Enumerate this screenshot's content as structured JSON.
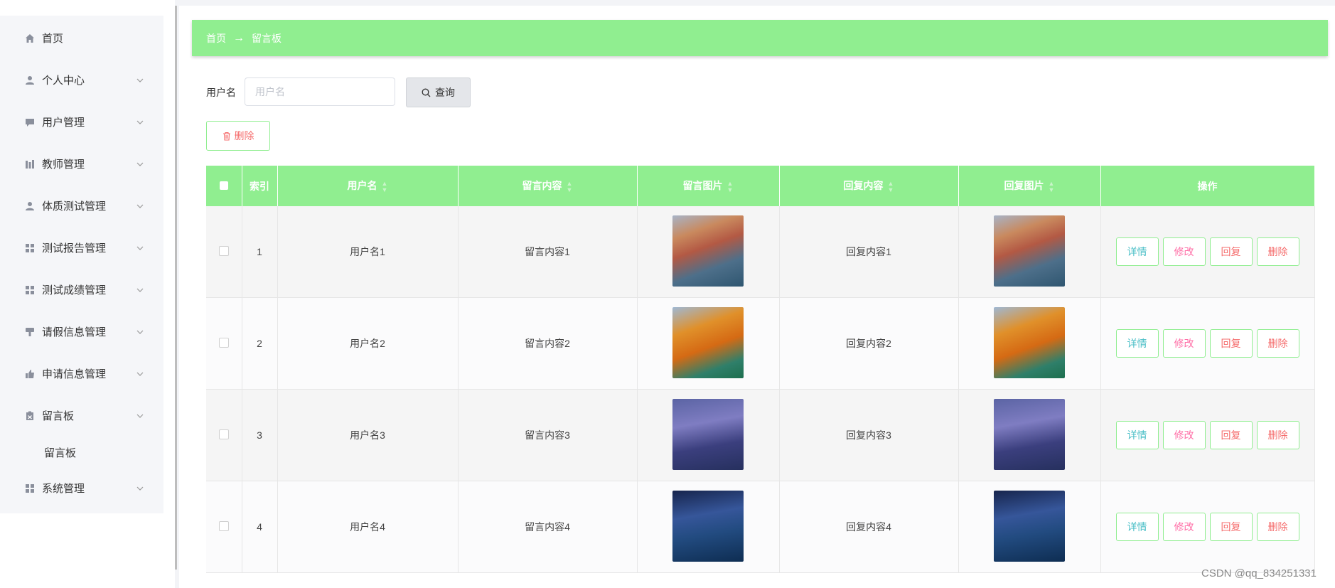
{
  "sidebar": {
    "items": [
      {
        "label": "首页",
        "icon": "home-icon",
        "has_arrow": false
      },
      {
        "label": "个人中心",
        "icon": "user-icon",
        "has_arrow": true
      },
      {
        "label": "用户管理",
        "icon": "chat-icon",
        "has_arrow": true
      },
      {
        "label": "教师管理",
        "icon": "bars-icon",
        "has_arrow": true
      },
      {
        "label": "体质测试管理",
        "icon": "user-icon",
        "has_arrow": true
      },
      {
        "label": "测试报告管理",
        "icon": "grid-icon",
        "has_arrow": true
      },
      {
        "label": "测试成绩管理",
        "icon": "grid-icon",
        "has_arrow": true
      },
      {
        "label": "请假信息管理",
        "icon": "brush-icon",
        "has_arrow": true
      },
      {
        "label": "申请信息管理",
        "icon": "thumb-icon",
        "has_arrow": true
      },
      {
        "label": "留言板",
        "icon": "clipboard-icon",
        "has_arrow": true
      },
      {
        "label": "系统管理",
        "icon": "grid-icon",
        "has_arrow": true
      }
    ],
    "sub_item": "留言板"
  },
  "breadcrumb": {
    "home": "首页",
    "arrow": "→",
    "current": "留言板"
  },
  "search": {
    "label": "用户名",
    "placeholder": "用户名",
    "value": "",
    "button": "查询"
  },
  "toolbar": {
    "delete": "删除"
  },
  "table": {
    "headers": [
      "索引",
      "用户名",
      "留言内容",
      "留言图片",
      "回复内容",
      "回复图片",
      "操作"
    ],
    "rows": [
      {
        "index": "1",
        "username": "用户名1",
        "content": "留言内容1",
        "reply": "回复内容1"
      },
      {
        "index": "2",
        "username": "用户名2",
        "content": "留言内容2",
        "reply": "回复内容2"
      },
      {
        "index": "3",
        "username": "用户名3",
        "content": "留言内容3",
        "reply": "回复内容3"
      },
      {
        "index": "4",
        "username": "用户名4",
        "content": "留言内容4",
        "reply": "回复内容4"
      }
    ],
    "actions": {
      "detail": "详情",
      "edit": "修改",
      "reply": "回复",
      "delete": "删除"
    }
  },
  "colors": {
    "accent": "#90ee90",
    "danger": "#f56c6c",
    "detail": "#4bbfc7",
    "edit": "#ff6fa7"
  },
  "watermark": "CSDN @qq_834251331"
}
